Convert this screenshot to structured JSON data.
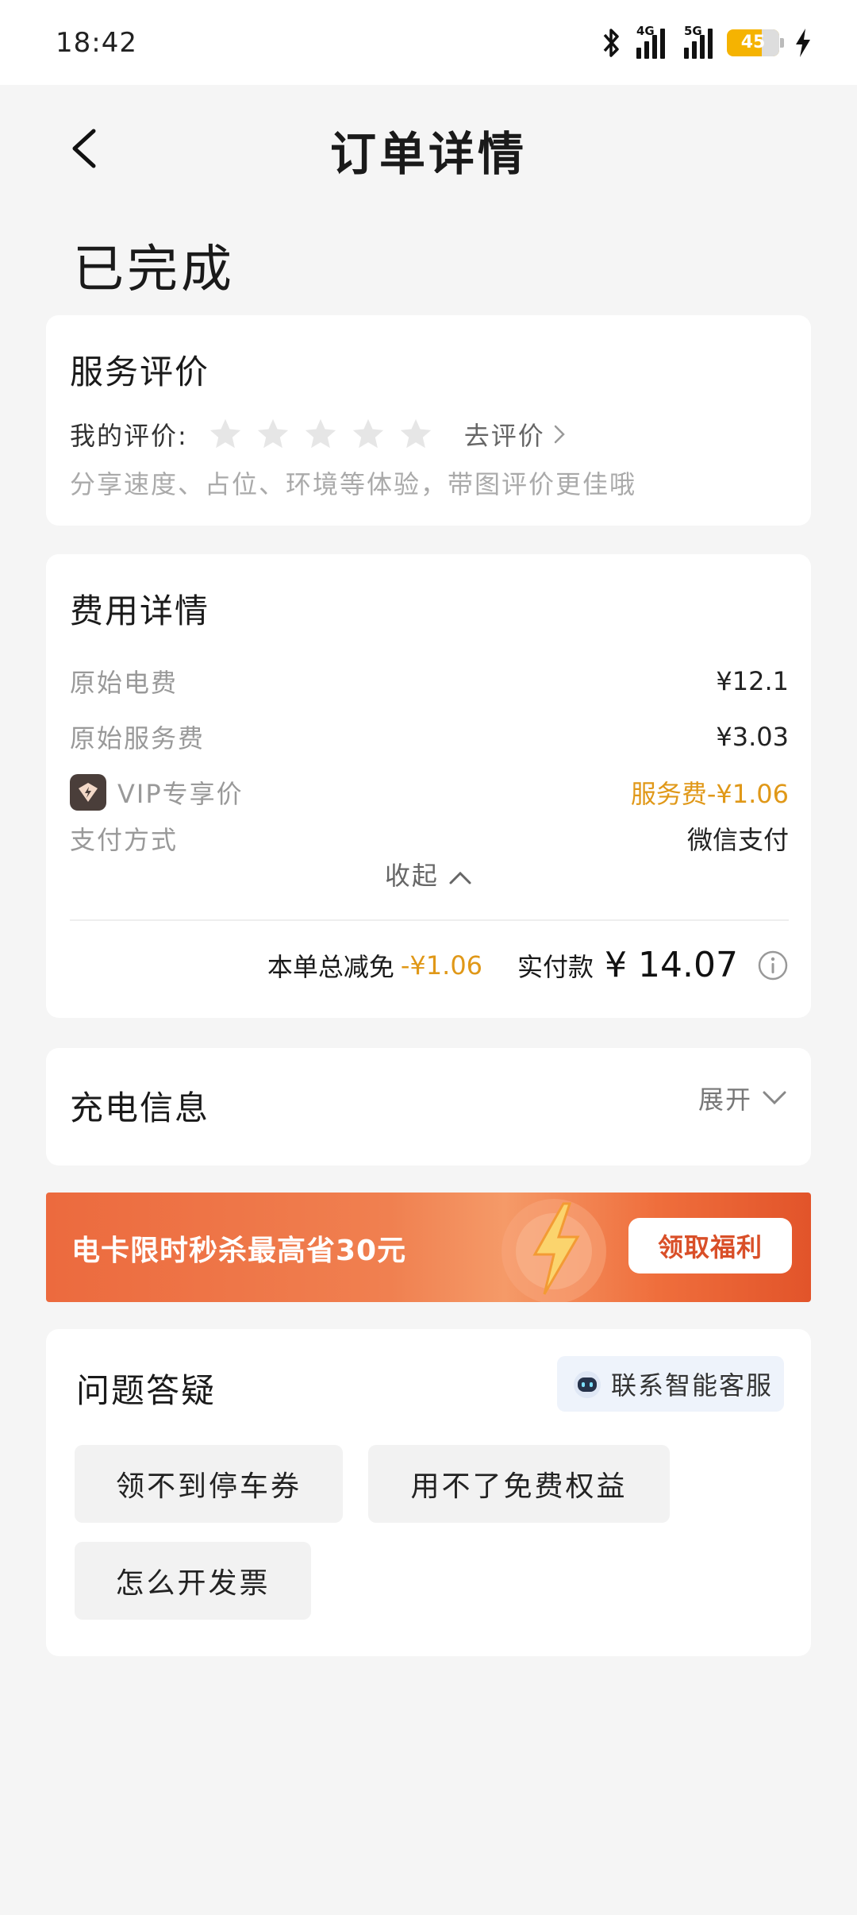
{
  "status_bar": {
    "time": "18:42",
    "battery": "45",
    "net1": "4G",
    "net2": "5G"
  },
  "nav": {
    "title": "订单详情"
  },
  "order": {
    "status": "已完成"
  },
  "service_rating": {
    "title": "服务评价",
    "my_rating_label": "我的评价:",
    "stars_filled": 0,
    "stars_total": 5,
    "go_rate": "去评价",
    "hint": "分享速度、占位、环境等体验，带图评价更佳哦"
  },
  "fee_details": {
    "title": "费用详情",
    "rows": [
      {
        "label": "原始电费",
        "value": "¥12.1"
      },
      {
        "label": "原始服务费",
        "value": "¥3.03"
      },
      {
        "label": "VIP专享价",
        "value": "服务费-¥1.06"
      },
      {
        "label": "支付方式",
        "value": "微信支付"
      }
    ],
    "collapse": "收起",
    "total_discount_label": "本单总减免",
    "total_discount": "-¥1.06",
    "paid_label": "实付款",
    "paid_amount": "¥ 14.07"
  },
  "charging_info": {
    "title": "充电信息",
    "expand": "展开"
  },
  "banner": {
    "text": "电卡限时秒杀最高省30元",
    "button": "领取福利"
  },
  "faq": {
    "title": "问题答疑",
    "contact": "联系智能客服",
    "questions": [
      "领不到停车券",
      "用不了免费权益",
      "怎么开发票"
    ]
  },
  "colors": {
    "accent_orange": "#e09818",
    "banner_red": "#e2542a",
    "background": "#f5f5f5"
  }
}
